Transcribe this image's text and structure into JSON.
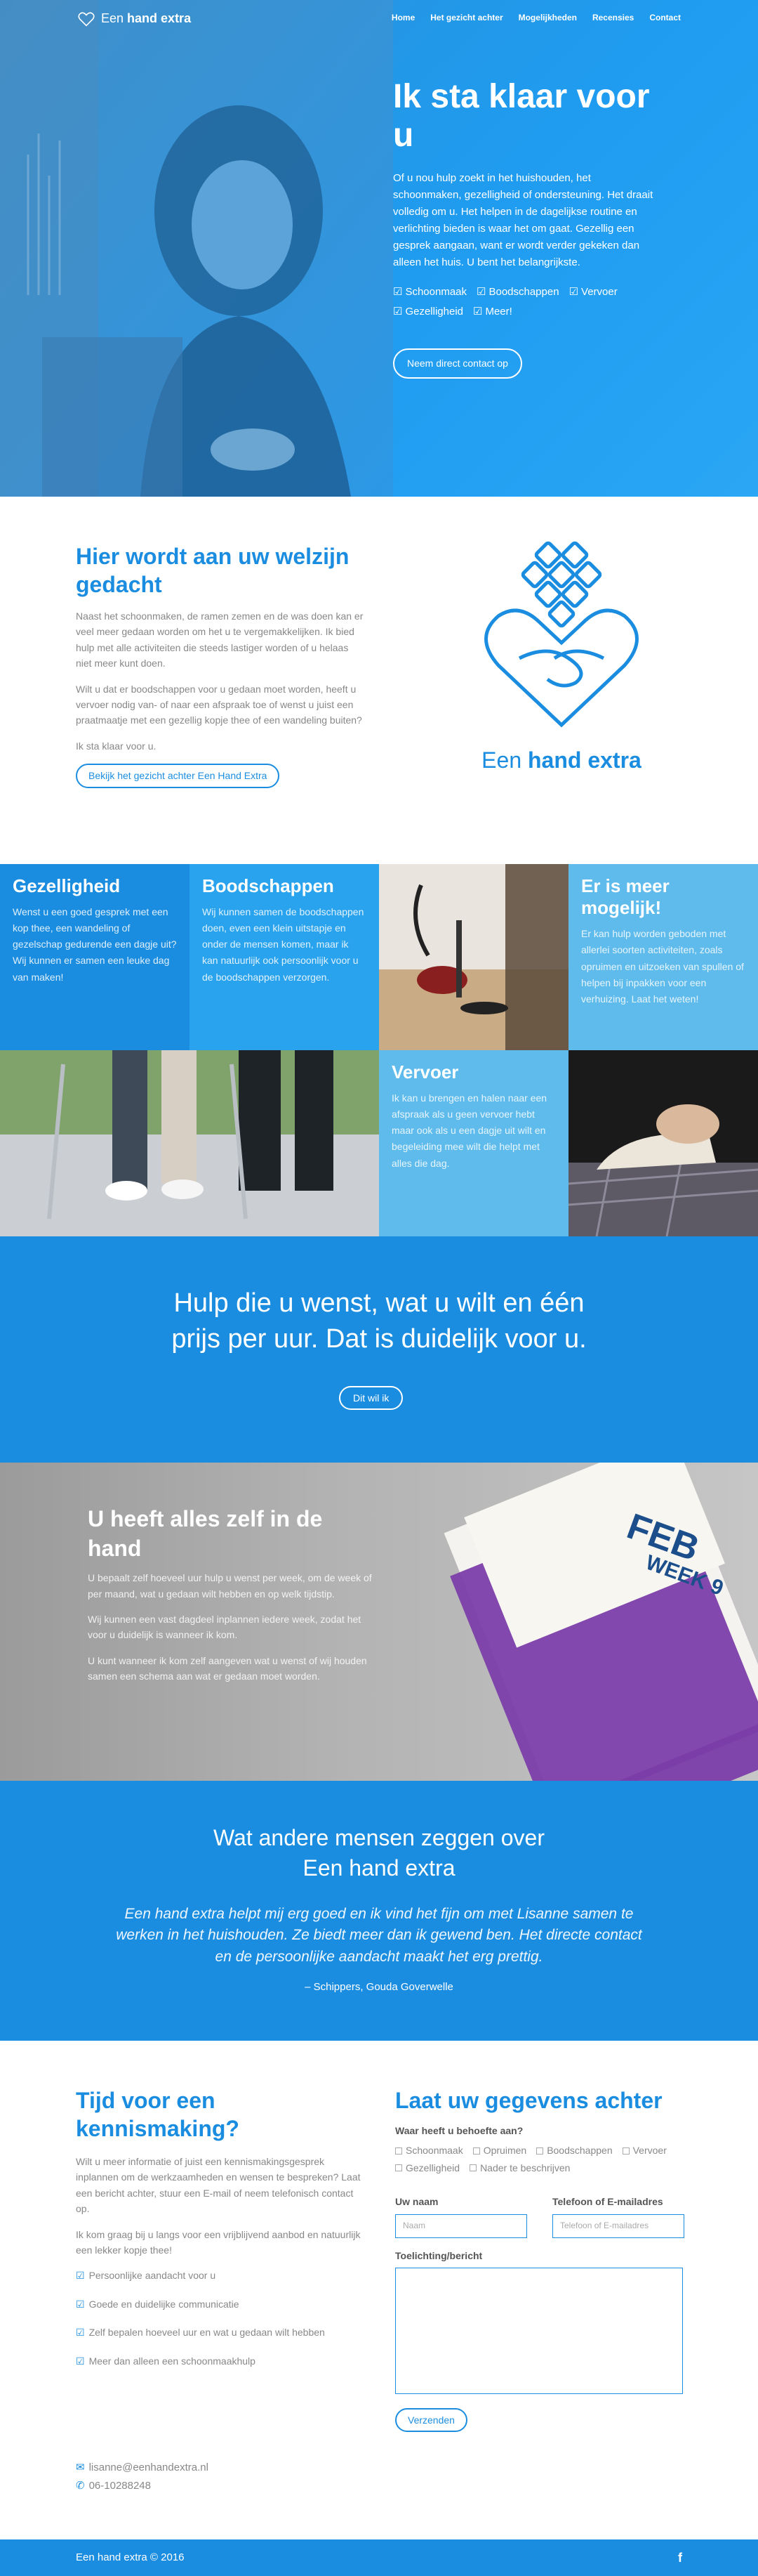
{
  "brand": {
    "name_regular": "Een",
    "name_bold": "hand extra",
    "accent": "#1b8de0",
    "light_accent": "#2aa6f5"
  },
  "nav": [
    "Home",
    "Het gezicht achter",
    "Mogelijkheden",
    "Recensies",
    "Contact"
  ],
  "hero": {
    "title": "Ik sta klaar voor u",
    "text": "Of u nou hulp zoekt in het huishouden, het schoonmaken, gezelligheid of ondersteuning. Het draait volledig om u. Het helpen in de dagelijkse routine en verlichting bieden is waar het om gaat. Gezellig een gesprek aangaan, want er wordt verder gekeken dan alleen het huis. U bent het belangrijkste.",
    "checks": [
      "Schoonmaak",
      "Boodschappen",
      "Vervoer",
      "Gezelligheid",
      "Meer!"
    ],
    "button": "Neem direct contact op"
  },
  "welcome": {
    "title": "Hier wordt aan uw welzijn gedacht",
    "p1": "Naast het schoonmaken, de ramen zemen en de was doen kan er veel meer gedaan worden om het u te vergemakkelijken. Ik bied hulp met alle activiteiten die steeds lastiger worden of u helaas niet meer kunt doen.",
    "p2": "Wilt u dat er boodschappen voor u gedaan moet worden, heeft u vervoer nodig van- of naar een afspraak toe of wenst u juist een praatmaatje met een gezellig kopje thee of een wandeling buiten?",
    "p3": "Ik sta klaar voor u.",
    "button": "Bekijk het gezicht achter Een Hand Extra",
    "logo_regular": "Een ",
    "logo_bold": "hand extra"
  },
  "services": {
    "gezelligheid": {
      "title": "Gezelligheid",
      "body": "Wenst u een goed gesprek met een kop thee, een wandeling of gezelschap gedurende een dagje uit? Wij kunnen er samen een leuke dag van maken!"
    },
    "boodschappen": {
      "title": "Boodschappen",
      "body": "Wij kunnen samen de boodschappen doen, even een klein uitstapje en onder de mensen komen, maar ik kan natuurlijk ook persoonlijk voor u de boodschappen verzorgen."
    },
    "meer": {
      "title": "Er is meer mogelijk!",
      "body": "Er kan hulp worden geboden met allerlei soorten activiteiten, zoals opruimen en uitzoeken van spullen of helpen bij inpakken voor een verhuizing. Laat het weten!"
    },
    "vervoer": {
      "title": "Vervoer",
      "body": "Ik kan u brengen en halen naar een afspraak als u geen vervoer hebt maar ook als u een dagje uit wilt en begeleiding mee wilt die helpt met alles die dag."
    }
  },
  "cta": {
    "title_line1": "Hulp die u wenst, wat u wilt en één",
    "title_line2": "prijs per uur. Dat is duidelijk voor u.",
    "button": "Dit wil ik"
  },
  "self": {
    "title": "U heeft alles zelf in de hand",
    "p1": "U bepaalt zelf hoeveel uur hulp u wenst per week, om de week of per maand, wat u gedaan wilt hebben en op welk tijdstip.",
    "p2": "Wij kunnen een vast dagdeel inplannen iedere week, zodat het voor u duidelijk is wanneer ik kom.",
    "p3": "U kunt wanneer ik kom zelf aangeven wat u wenst of wij houden samen een schema aan wat er gedaan moet worden.",
    "calendar_month": "FEB",
    "calendar_week": "WEEK 9"
  },
  "testimonial": {
    "title_line1": "Wat andere mensen zeggen over",
    "title_line2": "Een hand extra",
    "quote": "Een hand extra helpt mij erg goed en ik vind het fijn om met Lisanne samen te werken in het huishouden. Ze biedt meer dan ik gewend ben. Het directe contact en de persoonlijke aandacht maakt het erg prettig.",
    "author": "– Schippers, Gouda Goverwelle"
  },
  "contact": {
    "title": "Tijd voor een kennismaking?",
    "p1": "Wilt u meer informatie of juist een kennismakingsgesprek inplannen om de werkzaamheden en wensen te bespreken? Laat een bericht achter, stuur een E-mail of neem telefonisch contact op.",
    "p2": "Ik kom graag bij u langs voor een vrijblijvend aanbod en natuurlijk een lekker kopje thee!",
    "benefits": [
      "Persoonlijke aandacht voor u",
      "Goede en duidelijke communicatie",
      "Zelf bepalen hoeveel uur en wat u gedaan wilt hebben",
      "Meer dan alleen een schoonmaakhulp"
    ],
    "email": "lisanne@eenhandextra.nl",
    "phone": "06-10288248"
  },
  "form": {
    "title": "Laat uw gegevens achter",
    "needs_label": "Waar heeft u behoefte aan?",
    "options": [
      "Schoonmaak",
      "Opruimen",
      "Boodschappen",
      "Vervoer",
      "Gezelligheid",
      "Nader te beschrijven"
    ],
    "name_label": "Uw naam",
    "name_placeholder": "Naam",
    "contact_label": "Telefoon of E-mailadres",
    "contact_placeholder": "Telefoon of E-mailadres",
    "message_label": "Toelichting/bericht",
    "submit": "Verzenden"
  },
  "footer": {
    "copyright": "Een hand extra © 2016",
    "social_icon": "facebook-icon",
    "social_label": "f"
  }
}
